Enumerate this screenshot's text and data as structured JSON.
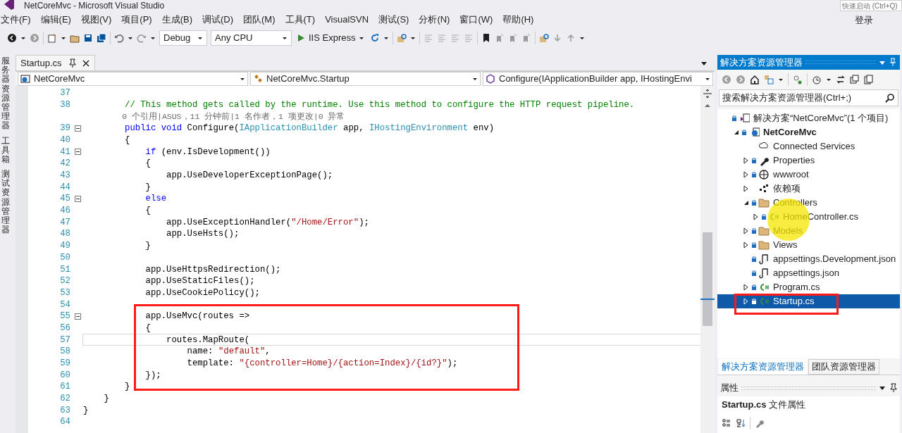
{
  "window": {
    "title": "NetCoreMvc - Microsoft Visual Studio",
    "quick_launch": {
      "placeholder": "快速启动 (Ctrl+Q)"
    },
    "sign_in": "登录"
  },
  "menu": [
    "文件(F)",
    "编辑(E)",
    "视图(V)",
    "项目(P)",
    "生成(B)",
    "调试(D)",
    "团队(M)",
    "工具(T)",
    "VisualSVN",
    "测试(S)",
    "分析(N)",
    "窗口(W)",
    "帮助(H)"
  ],
  "toolbar": {
    "configuration": "Debug",
    "platform": "Any CPU",
    "run": "IIS Express"
  },
  "side_tabs": [
    "服务器资源管理器",
    "工具箱",
    "测试资源管理器"
  ],
  "editor": {
    "tabs": [
      {
        "label": "Startup.cs",
        "selected": true
      }
    ],
    "nav": [
      "NetCoreMvc",
      "NetCoreMvc.Startup",
      "Configure(IApplicationBuilder app, IHostingEnvi"
    ],
    "lines": [
      {
        "num": "37",
        "fold": false
      },
      {
        "num": "38",
        "fold": false,
        "segments": [
          {
            "kind": "comment",
            "text": "        // This method gets called by the runtime. Use this method to configure the HTTP request pipeline."
          }
        ]
      },
      {
        "fold": false,
        "segments": [
          {
            "kind": "lens",
            "text": "        0 个引用|ASUS，11 分钟前|1 名作者，1 项更改|0 异常"
          }
        ]
      },
      {
        "num": "39",
        "fold": true,
        "segments": [
          {
            "kind": "keyword",
            "text": "        public void"
          },
          {
            "kind": "plain",
            "text": " Configure("
          },
          {
            "kind": "type",
            "text": "IApplicationBuilder"
          },
          {
            "kind": "plain",
            "text": " app, "
          },
          {
            "kind": "type",
            "text": "IHostingEnvironment"
          },
          {
            "kind": "plain",
            "text": " env)"
          }
        ]
      },
      {
        "num": "40",
        "fold": false,
        "segments": [
          {
            "kind": "plain",
            "text": "        {"
          }
        ]
      },
      {
        "num": "41",
        "fold": true,
        "segments": [
          {
            "kind": "keyword",
            "text": "            if"
          },
          {
            "kind": "plain",
            "text": " (env.IsDevelopment())"
          }
        ]
      },
      {
        "num": "42",
        "fold": false,
        "segments": [
          {
            "kind": "plain",
            "text": "            {"
          }
        ]
      },
      {
        "num": "43",
        "fold": false,
        "segments": [
          {
            "kind": "plain",
            "text": "                app.UseDeveloperExceptionPage();"
          }
        ]
      },
      {
        "num": "44",
        "fold": false,
        "segments": [
          {
            "kind": "plain",
            "text": "            }"
          }
        ]
      },
      {
        "num": "45",
        "fold": true,
        "segments": [
          {
            "kind": "keyword",
            "text": "            else"
          }
        ]
      },
      {
        "num": "46",
        "fold": false,
        "segments": [
          {
            "kind": "plain",
            "text": "            {"
          }
        ]
      },
      {
        "num": "47",
        "fold": false,
        "segments": [
          {
            "kind": "plain",
            "text": "                app.UseExceptionHandler("
          },
          {
            "kind": "string",
            "text": "\"/Home/Error\""
          },
          {
            "kind": "plain",
            "text": ");"
          }
        ]
      },
      {
        "num": "48",
        "fold": false,
        "segments": [
          {
            "kind": "plain",
            "text": "                app.UseHsts();"
          }
        ]
      },
      {
        "num": "49",
        "fold": false,
        "segments": [
          {
            "kind": "plain",
            "text": "            }"
          }
        ]
      },
      {
        "num": "50",
        "fold": false
      },
      {
        "num": "51",
        "fold": false,
        "segments": [
          {
            "kind": "plain",
            "text": "            app.UseHttpsRedirection();"
          }
        ]
      },
      {
        "num": "52",
        "fold": false,
        "segments": [
          {
            "kind": "plain",
            "text": "            app.UseStaticFiles();"
          }
        ]
      },
      {
        "num": "53",
        "fold": false,
        "segments": [
          {
            "kind": "plain",
            "text": "            app.UseCookiePolicy();"
          }
        ]
      },
      {
        "num": "54",
        "fold": false
      },
      {
        "num": "55",
        "fold": true,
        "segments": [
          {
            "kind": "plain",
            "text": "            app.UseMvc(routes =>"
          }
        ]
      },
      {
        "num": "56",
        "fold": false,
        "segments": [
          {
            "kind": "plain",
            "text": "            {"
          }
        ]
      },
      {
        "num": "57",
        "fold": false,
        "current": true,
        "segments": [
          {
            "kind": "plain",
            "text": "                routes.MapRoute("
          }
        ]
      },
      {
        "num": "58",
        "fold": false,
        "segments": [
          {
            "kind": "plain",
            "text": "                    name: "
          },
          {
            "kind": "string",
            "text": "\"default\""
          },
          {
            "kind": "plain",
            "text": ","
          }
        ]
      },
      {
        "num": "59",
        "fold": false,
        "segments": [
          {
            "kind": "plain",
            "text": "                    template: "
          },
          {
            "kind": "string",
            "text": "\"{controller=Home}/{action=Index}/{id?}\""
          },
          {
            "kind": "plain",
            "text": ");"
          }
        ]
      },
      {
        "num": "60",
        "fold": false,
        "segments": [
          {
            "kind": "plain",
            "text": "            });"
          }
        ]
      },
      {
        "num": "61",
        "fold": false,
        "segments": [
          {
            "kind": "plain",
            "text": "        }"
          }
        ]
      },
      {
        "num": "62",
        "fold": false,
        "segments": [
          {
            "kind": "plain",
            "text": "    }"
          }
        ]
      },
      {
        "num": "63",
        "fold": false,
        "segments": [
          {
            "kind": "plain",
            "text": "}"
          }
        ]
      },
      {
        "num": "64",
        "fold": false
      }
    ]
  },
  "solution_explorer": {
    "title": "解决方案资源管理器",
    "search": {
      "placeholder": "搜索解决方案资源管理器(Ctrl+;)"
    },
    "tree": [
      {
        "label": "解决方案“NetCoreMvc”(1 个项目)",
        "kind": "solution",
        "selected": false,
        "children": [
          {
            "label": "NetCoreMvc",
            "kind": "project",
            "expanded": true,
            "selected": false,
            "children": [
              {
                "label": "Connected Services",
                "kind": "cloud",
                "selected": false
              },
              {
                "label": "Properties",
                "kind": "wrench",
                "expanded": false,
                "selected": false
              },
              {
                "label": "wwwroot",
                "kind": "globe",
                "expanded": false,
                "selected": false
              },
              {
                "label": "依赖项",
                "kind": "deps",
                "expanded": false,
                "selected": false
              },
              {
                "label": "Controllers",
                "kind": "folder",
                "expanded": true,
                "selected": false,
                "children": [
                  {
                    "label": "HomeController.cs",
                    "kind": "csharp",
                    "expanded": false,
                    "selected": false
                  }
                ]
              },
              {
                "label": "Models",
                "kind": "folder",
                "expanded": false,
                "selected": false
              },
              {
                "label": "Views",
                "kind": "folder",
                "expanded": false,
                "selected": false
              },
              {
                "label": "appsettings.Development.json",
                "kind": "json",
                "selected": false
              },
              {
                "label": "appsettings.json",
                "kind": "json",
                "selected": false
              },
              {
                "label": "Program.cs",
                "kind": "csharp",
                "expanded": false,
                "selected": false
              },
              {
                "label": "Startup.cs",
                "kind": "csharp",
                "expanded": false,
                "selected": true
              }
            ]
          }
        ]
      }
    ],
    "tabs": [
      {
        "label": "解决方案资源管理器",
        "selected": true
      },
      {
        "label": "团队资源管理器",
        "selected": false
      }
    ]
  },
  "properties": {
    "title": "属性",
    "subject": "**Startup.cs** 文件属性"
  }
}
